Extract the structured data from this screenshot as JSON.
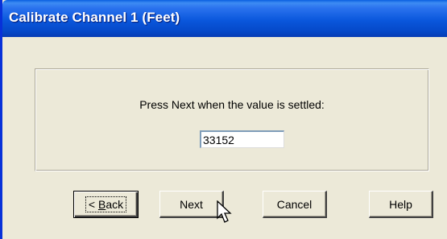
{
  "window": {
    "title": "Calibrate Channel 1 (Feet)"
  },
  "panel": {
    "prompt": "Press Next when the value is settled:",
    "value": "33152"
  },
  "buttons": {
    "back_prefix": "< ",
    "back_accel": "B",
    "back_rest": "ack",
    "next": "Next",
    "cancel": "Cancel",
    "help": "Help"
  },
  "cursor": {
    "icon": "arrow-cursor-icon"
  },
  "colors": {
    "titlebar": "#0a57dc",
    "window_bg": "#ece9d8",
    "field_border": "#7f9db9"
  }
}
